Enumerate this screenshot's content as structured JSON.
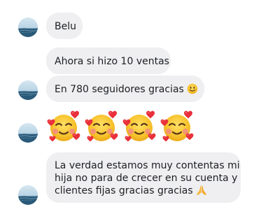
{
  "thread": {
    "messages": [
      {
        "text": "Belu"
      },
      {
        "text": "Ahora si hizo 10 ventas"
      },
      {
        "text": "En 780 seguidores gracias",
        "trailing_emoji": "smiling-face-emoji"
      },
      {
        "emojis": [
          "smiling-face-with-hearts-emoji",
          "smiling-face-with-hearts-emoji",
          "smiling-face-with-hearts-emoji",
          "smiling-face-with-hearts-emoji"
        ]
      },
      {
        "lines": [
          "La verdad estamos muy contentas mi",
          "hija no para de crecer en su cuenta y",
          "clientes fijas gracias gracias"
        ],
        "trailing_emoji": "folded-hands-emoji"
      }
    ]
  },
  "colors": {
    "bubble_bg": "#efeff1",
    "text": "#1c1e21",
    "emoji_yellow": "#f7c22b",
    "heart_red": "#e8313b"
  }
}
